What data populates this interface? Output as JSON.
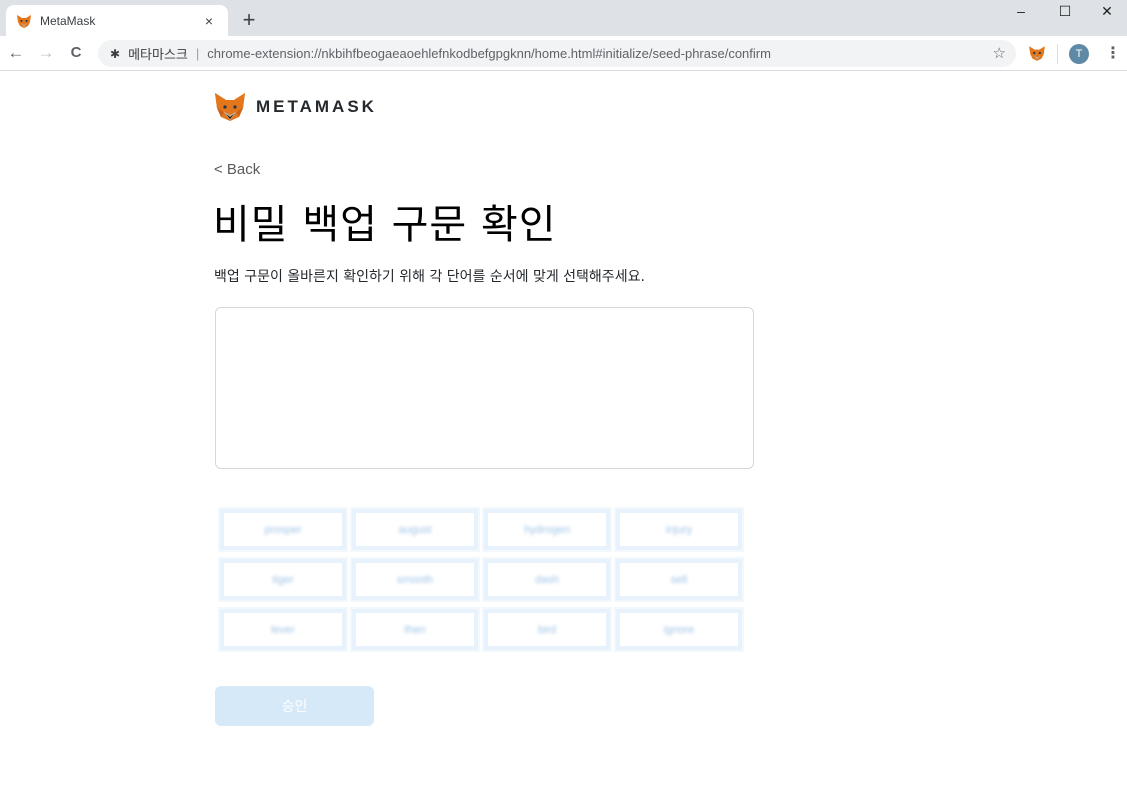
{
  "browser": {
    "tab_title": "MetaMask",
    "tab_close": "×",
    "new_tab": "+",
    "minimize": "–",
    "maximize": "☐",
    "close": "✕",
    "back": "←",
    "forward": "→",
    "reload": "C",
    "origin_label": "메타마스크",
    "url": "chrome-extension://nkbihfbeogaeaoehlefnkodbefgpgknn/home.html#initialize/seed-phrase/confirm",
    "bookmark_icon": "star-icon",
    "profile_initial": "T",
    "menu": "⋮"
  },
  "page": {
    "brand": "METAMASK",
    "back_link": "< Back",
    "title": "비밀 백업 구문 확인",
    "description": "백업 구문이 올바른지 확인하기 위해 각 단어를 순서에 맞게 선택해주세요.",
    "words": [
      "prosper",
      "august",
      "hydrogen",
      "injury",
      "tiger",
      "smooth",
      "dash",
      "sell",
      "lever",
      "then",
      "bird",
      "ignore"
    ],
    "confirm_label": "승인"
  },
  "colors": {
    "accent_disabled": "#d6e9f9",
    "word_border": "#e8f2fc"
  }
}
